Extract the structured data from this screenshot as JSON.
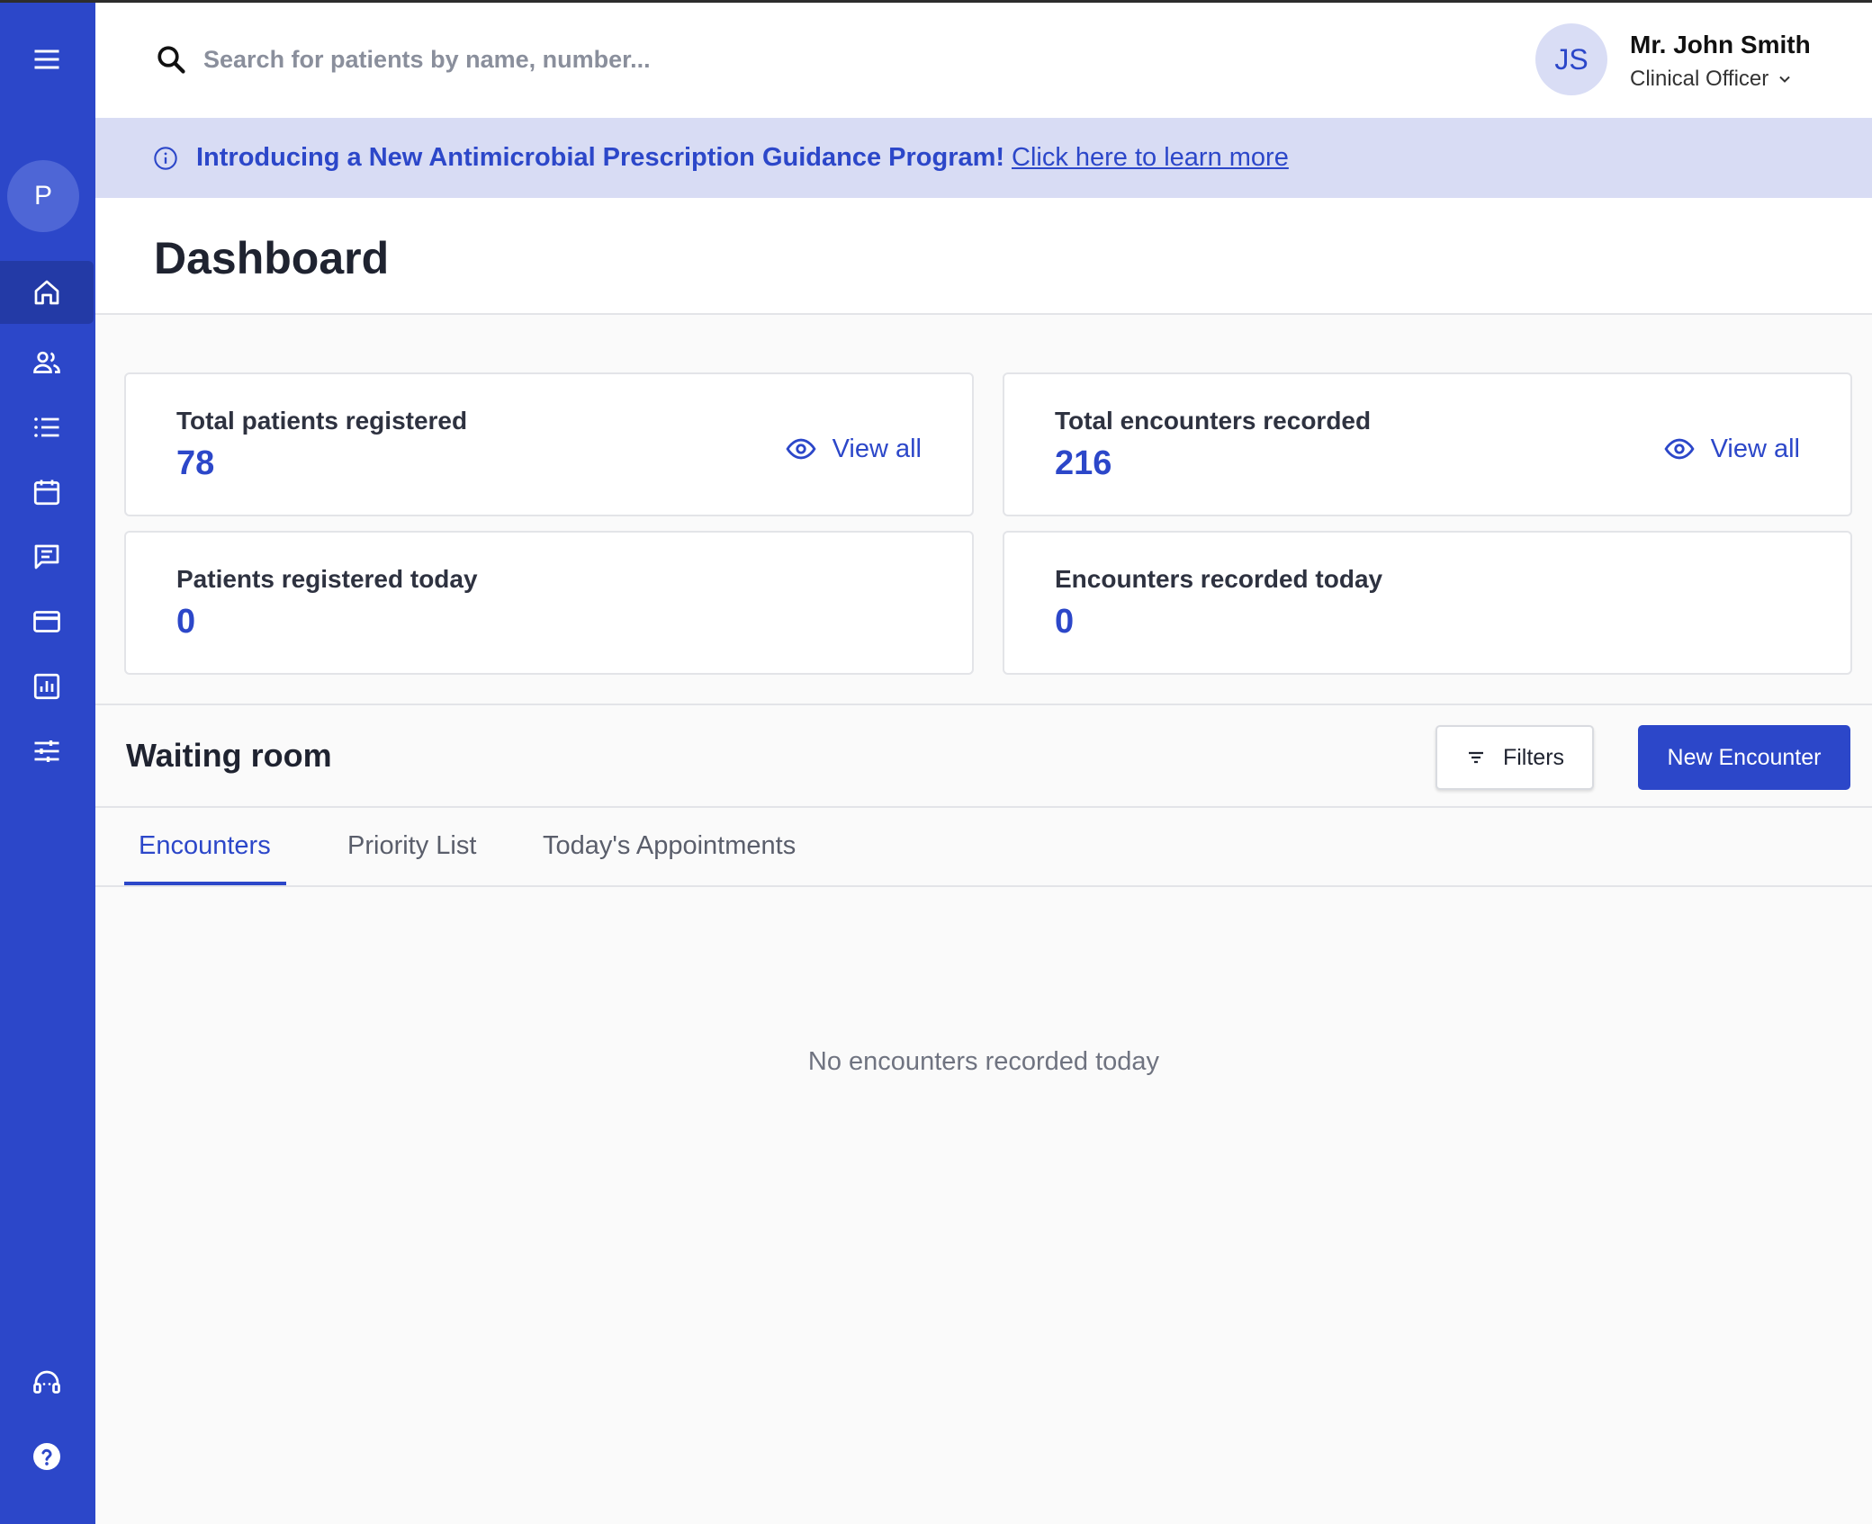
{
  "sidebar": {
    "org_initial": "P",
    "nav_items": [
      {
        "name": "home",
        "icon": "home-icon",
        "active": true
      },
      {
        "name": "patients",
        "icon": "people-icon"
      },
      {
        "name": "lists",
        "icon": "list-icon"
      },
      {
        "name": "appointments",
        "icon": "calendar-icon"
      },
      {
        "name": "messages",
        "icon": "message-icon"
      },
      {
        "name": "billing",
        "icon": "card-icon"
      },
      {
        "name": "reports",
        "icon": "chart-icon"
      },
      {
        "name": "settings",
        "icon": "sliders-icon"
      }
    ],
    "bottom_items": [
      {
        "name": "support",
        "icon": "headset-icon"
      },
      {
        "name": "help",
        "icon": "help-icon"
      }
    ]
  },
  "header": {
    "search_placeholder": "Search for patients by name, number...",
    "user_initials": "JS",
    "user_name": "Mr. John Smith",
    "user_role": "Clinical Officer"
  },
  "banner": {
    "text": "Introducing a New Antimicrobial Prescription Guidance Program!",
    "link": "Click here to learn more"
  },
  "page": {
    "title": "Dashboard"
  },
  "stats": {
    "total_patients": {
      "label": "Total patients registered",
      "value": "78",
      "action": "View all"
    },
    "total_encounters": {
      "label": "Total encounters recorded",
      "value": "216",
      "action": "View all"
    },
    "patients_today": {
      "label": "Patients registered today",
      "value": "0"
    },
    "encounters_today": {
      "label": "Encounters recorded today",
      "value": "0"
    }
  },
  "waiting_room": {
    "title": "Waiting room",
    "filters_label": "Filters",
    "new_encounter_label": "New Encounter",
    "tabs": [
      {
        "label": "Encounters",
        "active": true
      },
      {
        "label": "Priority List"
      },
      {
        "label": "Today's Appointments"
      }
    ],
    "empty_message": "No encounters recorded today"
  },
  "colors": {
    "primary": "#2c47c9",
    "sidebar_active": "#233aa6",
    "banner_bg": "#d8dcf4",
    "avatar_bg": "#d9ddf5"
  }
}
